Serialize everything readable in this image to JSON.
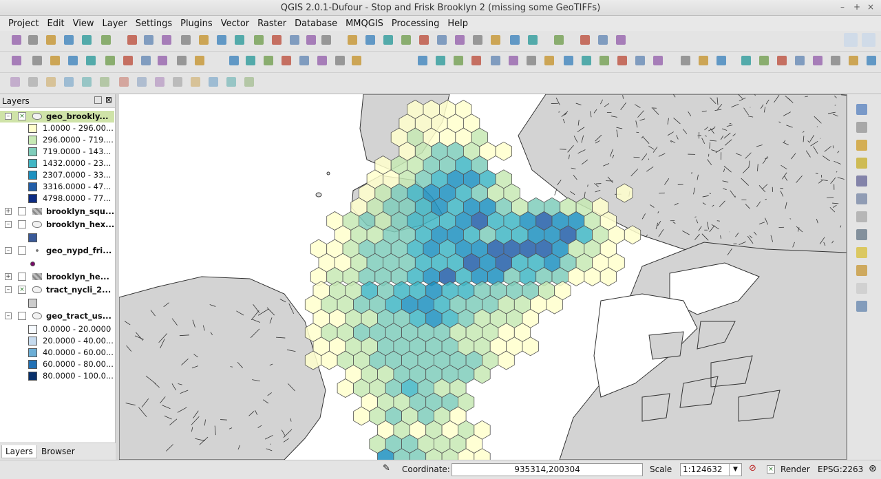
{
  "window": {
    "title": "QGIS 2.0.1-Dufour - Stop and Frisk Brooklyn 2 (missing some GeoTIFFs)"
  },
  "menu": [
    "Project",
    "Edit",
    "View",
    "Layer",
    "Settings",
    "Plugins",
    "Vector",
    "Raster",
    "Database",
    "MMQGIS",
    "Processing",
    "Help"
  ],
  "layers_panel": {
    "title": "Layers",
    "layers": [
      {
        "name": "geo_brookly...",
        "expanded": true,
        "checked": true,
        "selected": true,
        "classes": [
          {
            "label": "1.0000 - 296.00...",
            "color": "#ffffcc"
          },
          {
            "label": "296.0000 - 719....",
            "color": "#c7e9b4"
          },
          {
            "label": "719.0000 - 143...",
            "color": "#7fcdbb"
          },
          {
            "label": "1432.0000 - 23...",
            "color": "#41b6c4"
          },
          {
            "label": "2307.0000 - 33...",
            "color": "#1d91c0"
          },
          {
            "label": "3316.0000 - 47...",
            "color": "#225ea8"
          },
          {
            "label": "4798.0000 - 77...",
            "color": "#0c2c84"
          }
        ]
      },
      {
        "name": "brooklyn_squ...",
        "expanded": false,
        "checked": false
      },
      {
        "name": "brooklyn_hex...",
        "expanded": true,
        "checked": false,
        "symbol_color": "#3a5a98"
      },
      {
        "name": "geo_nypd_fri...",
        "expanded": true,
        "checked": false,
        "symbol_color": "#7a0a6a"
      },
      {
        "name": "brooklyn_he...",
        "expanded": false,
        "checked": false
      },
      {
        "name": "tract_nycli_2...",
        "expanded": true,
        "checked": true,
        "symbol_color": "#cccccc"
      },
      {
        "name": "geo_tract_us...",
        "expanded": true,
        "checked": false,
        "classes": [
          {
            "label": "0.0000 - 20.0000",
            "color": "#f7fbff"
          },
          {
            "label": "20.0000 - 40.00...",
            "color": "#c6dbef"
          },
          {
            "label": "40.0000 - 60.00...",
            "color": "#6baed6"
          },
          {
            "label": "60.0000 - 80.00...",
            "color": "#2171b5"
          },
          {
            "label": "80.0000 - 100.0...",
            "color": "#08306b"
          }
        ]
      }
    ],
    "tabs": [
      "Layers",
      "Browser"
    ]
  },
  "status": {
    "coordinate_label": "Coordinate:",
    "coordinate_value": "935314,200304",
    "scale_label": "Scale",
    "scale_value": "1:124632",
    "render_label": "Render",
    "crs": "EPSG:2263"
  }
}
